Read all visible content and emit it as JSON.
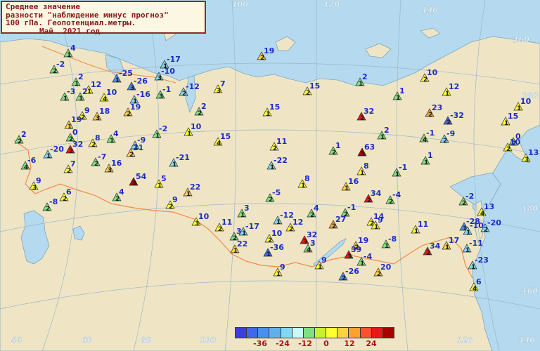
{
  "title": {
    "line1": "Среднее значение",
    "line2": "разности \"наблюдение минус прогноз\"",
    "line3": "100 гПа. Геопотенциал.метры.",
    "line4": "Май  2021 год."
  },
  "colors": {
    "water": "#b5d9ee",
    "land": "#efe5c4",
    "border_line": "#f08a4a",
    "number_text": "#1c2cc8",
    "grid": "#9bb7c9",
    "scale": [
      "#3c3ce0",
      "#4068e8",
      "#4a90e8",
      "#60b0ec",
      "#80d8f4",
      "#c8fafa",
      "#7ee07e",
      "#c8f030",
      "#ffff30",
      "#ffd040",
      "#ffa030",
      "#ff5030",
      "#e81818",
      "#a80000"
    ]
  },
  "legend": {
    "labels": [
      "-36",
      "-24",
      "-12",
      "0",
      "12",
      "24"
    ]
  },
  "grid_labels": [
    "60",
    "80",
    "100",
    "120",
    "140",
    "160",
    "180",
    "40",
    "60",
    "80",
    "100",
    "120",
    "140",
    "160",
    "180"
  ],
  "stations": [
    {
      "v": "4",
      "c": "1",
      "col": "#7ee07e"
    },
    {
      "v": "-2",
      "c": "2",
      "col": "#7ee07e"
    },
    {
      "v": "2",
      "c": "1",
      "col": "#7ee07e"
    },
    {
      "v": "12",
      "c": "1",
      "col": "#ffff30"
    },
    {
      "v": "-3",
      "c": "1",
      "col": "#7ee07e"
    },
    {
      "v": "2",
      "c": "1",
      "col": "#7ee07e"
    },
    {
      "v": "-25",
      "c": "1",
      "col": "#4a90e8"
    },
    {
      "v": "-26",
      "c": "3",
      "col": "#4a90e8"
    },
    {
      "v": "10",
      "c": "4",
      "col": "#ffff30"
    },
    {
      "v": "-16",
      "c": "1",
      "col": "#80d8f4"
    },
    {
      "v": "-10",
      "c": "3",
      "col": "#80d8f4"
    },
    {
      "v": "-17",
      "c": "1",
      "col": "#80d8f4"
    },
    {
      "v": "-1",
      "c": "3",
      "col": "#7ee07e"
    },
    {
      "v": "-12",
      "c": "2",
      "col": "#80d8f4"
    },
    {
      "v": "19",
      "c": "2",
      "col": "#ffd040"
    },
    {
      "v": "7",
      "c": "3",
      "col": "#ffff30"
    },
    {
      "v": "15",
      "c": "2",
      "col": "#ffff30"
    },
    {
      "v": "2",
      "c": "1",
      "col": "#7ee07e"
    },
    {
      "v": "1",
      "c": "1",
      "col": "#7ee07e"
    },
    {
      "v": "10",
      "c": "2",
      "col": "#ffff30"
    },
    {
      "v": "12",
      "c": "1",
      "col": "#ffff30"
    },
    {
      "v": "19",
      "c": "2",
      "col": "#ffd040"
    },
    {
      "v": "9",
      "c": "2",
      "col": "#ffff30"
    },
    {
      "v": "18",
      "c": "3",
      "col": "#ffd040"
    },
    {
      "v": "19",
      "c": "1",
      "col": "#ffd040"
    },
    {
      "v": "2",
      "c": "2",
      "col": "#7ee07e"
    },
    {
      "v": "15",
      "c": "1",
      "col": "#ffff30"
    },
    {
      "v": "32",
      "c": "2",
      "col": "#e81818"
    },
    {
      "v": "23",
      "c": "2",
      "col": "#ffa030"
    },
    {
      "v": "-32",
      "c": "2",
      "col": "#4068e8"
    },
    {
      "v": "15",
      "c": "1",
      "col": "#ffff30"
    },
    {
      "v": "10",
      "c": "1",
      "col": "#ffff30"
    },
    {
      "v": "0",
      "c": "2",
      "col": "#7ee07e"
    },
    {
      "v": "2",
      "c": "1",
      "col": "#7ee07e"
    },
    {
      "v": "-1",
      "c": "4",
      "col": "#7ee07e"
    },
    {
      "v": "-9",
      "c": "2",
      "col": "#80d8f4"
    },
    {
      "v": "10",
      "c": "2",
      "col": "#ffff30"
    },
    {
      "v": "13",
      "c": "3",
      "col": "#ffff30"
    },
    {
      "v": "2",
      "c": "2",
      "col": "#7ee07e"
    },
    {
      "v": "0",
      "c": "2",
      "col": "#7ee07e"
    },
    {
      "v": "32",
      "c": "2",
      "col": "#e81818"
    },
    {
      "v": "-20",
      "c": "1",
      "col": "#80d8f4"
    },
    {
      "v": "8",
      "c": "2",
      "col": "#ffff30"
    },
    {
      "v": "4",
      "c": "1",
      "col": "#7ee07e"
    },
    {
      "v": "-9",
      "c": "1",
      "col": "#80d8f4"
    },
    {
      "v": "-2",
      "c": "1",
      "col": "#7ee07e"
    },
    {
      "v": "10",
      "c": "1",
      "col": "#ffff30"
    },
    {
      "v": "15",
      "c": "4",
      "col": "#ffff30"
    },
    {
      "v": "11",
      "c": "2",
      "col": "#ffff30"
    },
    {
      "v": "1",
      "c": "2",
      "col": "#7ee07e"
    },
    {
      "v": "63",
      "c": "3",
      "col": "#a80000"
    },
    {
      "v": "1",
      "c": "1",
      "col": "#7ee07e"
    },
    {
      "v": "-6",
      "c": "4",
      "col": "#7ee07e"
    },
    {
      "v": "7",
      "c": "2",
      "col": "#ffff30"
    },
    {
      "v": "-7",
      "c": "2",
      "col": "#7ee07e"
    },
    {
      "v": "16",
      "c": "3",
      "col": "#ffd040"
    },
    {
      "v": "21",
      "c": "2",
      "col": "#ffd040"
    },
    {
      "v": "-21",
      "c": "1",
      "col": "#80d8f4"
    },
    {
      "v": "-22",
      "c": "1",
      "col": "#80d8f4"
    },
    {
      "v": "8",
      "c": "1",
      "col": "#ffff30"
    },
    {
      "v": "-1",
      "c": "1",
      "col": "#7ee07e"
    },
    {
      "v": "9",
      "c": "3",
      "col": "#ffff30"
    },
    {
      "v": "6",
      "c": "2",
      "col": "#ffff30"
    },
    {
      "v": "54",
      "c": "2",
      "col": "#a80000"
    },
    {
      "v": "5",
      "c": "1",
      "col": "#ffff30"
    },
    {
      "v": "8",
      "c": "1",
      "col": "#ffff30"
    },
    {
      "v": "16",
      "c": "1",
      "col": "#ffd040"
    },
    {
      "v": "-8",
      "c": "2",
      "col": "#7ee07e"
    },
    {
      "v": "9",
      "c": "2",
      "col": "#ffff30"
    },
    {
      "v": "4",
      "c": "2",
      "col": "#7ee07e"
    },
    {
      "v": "22",
      "c": "1",
      "col": "#ffd040"
    },
    {
      "v": "-5",
      "c": "2",
      "col": "#7ee07e"
    },
    {
      "v": "34",
      "c": "2",
      "col": "#e81818"
    },
    {
      "v": "-4",
      "c": "2",
      "col": "#7ee07e"
    },
    {
      "v": "-2",
      "c": "2",
      "col": "#7ee07e"
    },
    {
      "v": "13",
      "c": "4",
      "col": "#ffff30"
    },
    {
      "v": "-28",
      "c": "1",
      "col": "#4a90e8"
    },
    {
      "v": "3",
      "c": "1",
      "col": "#7ee07e"
    },
    {
      "v": "4",
      "c": "2",
      "col": "#7ee07e"
    },
    {
      "v": "-1",
      "c": "2",
      "col": "#7ee07e"
    },
    {
      "v": "10",
      "c": "3",
      "col": "#ffff30"
    },
    {
      "v": "11",
      "c": "2",
      "col": "#ffff30"
    },
    {
      "v": "-17",
      "c": "1",
      "col": "#80d8f4"
    },
    {
      "v": "14",
      "c": "2",
      "col": "#ffff30"
    },
    {
      "v": "-12",
      "c": "1",
      "col": "#80d8f4"
    },
    {
      "v": "27",
      "c": "2",
      "col": "#ffa030"
    },
    {
      "v": "9",
      "c": "1",
      "col": "#ffff30"
    },
    {
      "v": "11",
      "c": "1",
      "col": "#ffff30"
    },
    {
      "v": "-10",
      "c": "1",
      "col": "#80d8f4"
    },
    {
      "v": "-20",
      "c": "2",
      "col": "#80d8f4"
    },
    {
      "v": "12",
      "c": "2",
      "col": "#ffff30"
    },
    {
      "v": "10",
      "c": "2",
      "col": "#ffff30"
    },
    {
      "v": "3",
      "c": "2",
      "col": "#7ee07e"
    },
    {
      "v": "32",
      "c": "3",
      "col": "#e81818"
    },
    {
      "v": "19",
      "c": "2",
      "col": "#ffd040"
    },
    {
      "v": "-8",
      "c": "1",
      "col": "#7ee07e"
    },
    {
      "v": "34",
      "c": "2",
      "col": "#e81818"
    },
    {
      "v": "17",
      "c": "1",
      "col": "#ffd040"
    },
    {
      "v": "-11",
      "c": "1",
      "col": "#80d8f4"
    },
    {
      "v": "22",
      "c": "1",
      "col": "#ffd040"
    },
    {
      "v": "-36",
      "c": "1",
      "col": "#4068e8"
    },
    {
      "v": "3",
      "c": "4",
      "col": "#7ee07e"
    },
    {
      "v": "39",
      "c": "3",
      "col": "#e81818"
    },
    {
      "v": "9",
      "c": "1",
      "col": "#ffff30"
    },
    {
      "v": "-4",
      "c": "1",
      "col": "#7ee07e"
    },
    {
      "v": "-23",
      "c": "1",
      "col": "#80d8f4"
    },
    {
      "v": "20",
      "c": "2",
      "col": "#ffd040"
    },
    {
      "v": "9",
      "c": "1",
      "col": "#ffff30"
    },
    {
      "v": "-26",
      "c": "2",
      "col": "#4a90e8"
    },
    {
      "v": "6",
      "c": "4",
      "col": "#ffff30"
    },
    {
      "v": "-3",
      "c": "3",
      "col": "#7ee07e"
    },
    {
      "v": "20",
      "c": "3",
      "col": "#ffd040"
    },
    {
      "v": "1",
      "c": "1",
      "col": "#7ee07e"
    },
    {
      "v": "15",
      "c": "1",
      "col": "#ffff30"
    }
  ]
}
